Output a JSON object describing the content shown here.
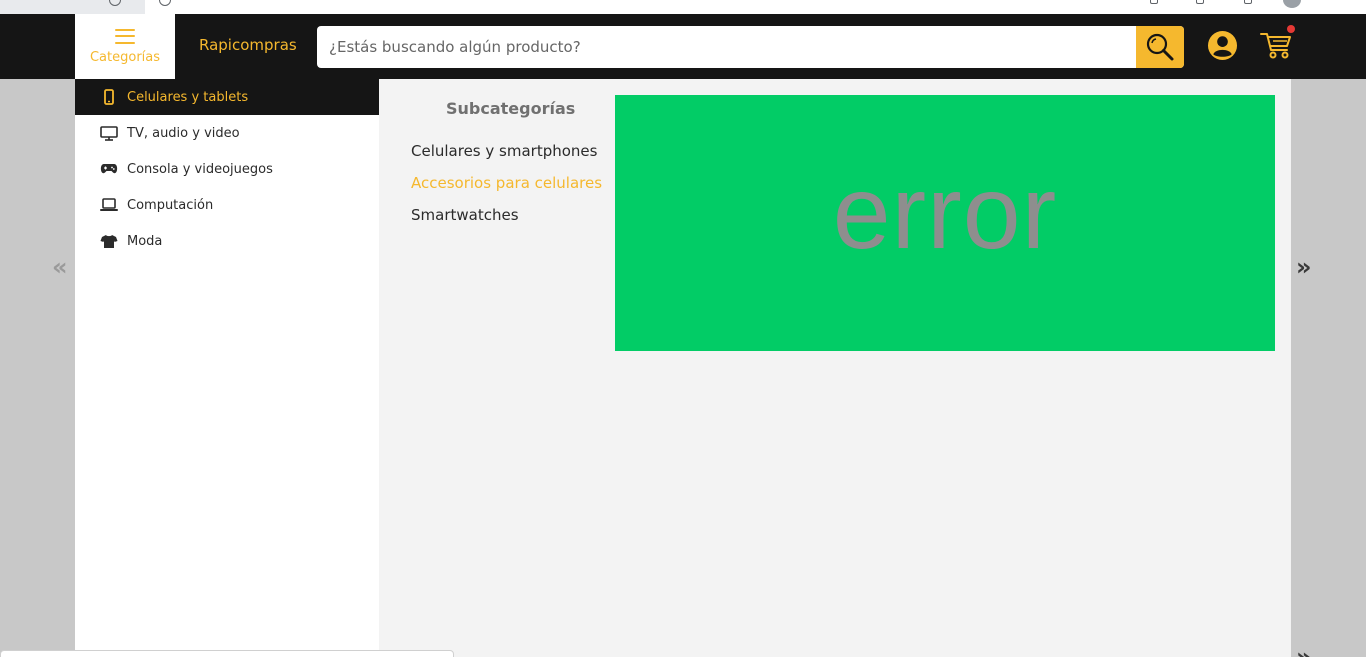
{
  "header": {
    "categories_label": "Categorías",
    "brand": "Rapicompras",
    "search_placeholder": "¿Estás buscando algún producto?",
    "search_icon": "search-icon",
    "user_icon": "user-icon",
    "cart_icon": "cart-icon",
    "accent_color": "#f5b82e",
    "bar_color": "#151515"
  },
  "sidebar": {
    "items": [
      {
        "label": "Celulares y tablets",
        "icon": "phone-icon",
        "active": true
      },
      {
        "label": "TV, audio y video",
        "icon": "monitor-icon",
        "active": false
      },
      {
        "label": "Consola y videojuegos",
        "icon": "gamepad-icon",
        "active": false
      },
      {
        "label": "Computación",
        "icon": "laptop-icon",
        "active": false
      },
      {
        "label": "Moda",
        "icon": "shirt-icon",
        "active": false
      }
    ]
  },
  "subcategories": {
    "title": "Subcategorías",
    "items": [
      {
        "label": "Celulares y smartphones",
        "highlighted": false
      },
      {
        "label": "Accesorios para celulares",
        "highlighted": true
      },
      {
        "label": "Smartwatches",
        "highlighted": false
      }
    ]
  },
  "banner": {
    "text": "error",
    "background": "#02cc66"
  },
  "carousel": {
    "prev": "«",
    "next": "»"
  }
}
